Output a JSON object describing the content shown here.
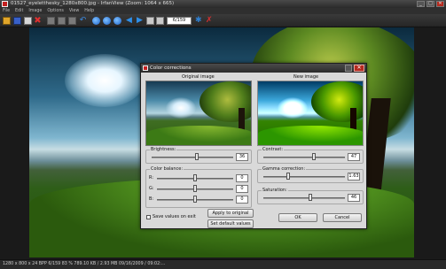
{
  "window": {
    "title": "01527_eyeletthesky_1280x800.jpg - IrfanView (Zoom: 1064 x 665)",
    "controls": [
      "_",
      "□",
      "✕"
    ]
  },
  "menu": [
    "File",
    "Edit",
    "Image",
    "Options",
    "View",
    "Help"
  ],
  "toolbar": {
    "page_counter": "6/159",
    "icons": [
      "folder-open-icon",
      "save-icon",
      "print-icon",
      "delete-icon",
      "cut-icon",
      "copy-icon",
      "paste-icon",
      "undo-icon",
      "zoom-in-icon",
      "zoom-out-icon",
      "previous-icon",
      "next-icon",
      "fit-icon",
      "fullscreen-icon",
      "tools-icon",
      "exit-icon"
    ]
  },
  "statusbar": {
    "text": "1280 x 800 x 24 BPP   6/159   83 %   789.10 KB / 2.93 MB   09/16/2009 / 09:02:..."
  },
  "dialog": {
    "title": "Color corrections",
    "original_label": "Original image",
    "new_label": "New image",
    "brightness": {
      "label": "Brightness:",
      "value": "36",
      "level": 0.55
    },
    "contrast": {
      "label": "Contrast:",
      "value": "47",
      "level": 0.62
    },
    "color_balance": {
      "title": "Color balance:",
      "channels": [
        {
          "label": "R:",
          "value": "0",
          "level": 0.5
        },
        {
          "label": "G:",
          "value": "0",
          "level": 0.5
        },
        {
          "label": "B:",
          "value": "0",
          "level": 0.5
        }
      ]
    },
    "gamma": {
      "label": "Gamma correction:",
      "value": "1.63",
      "level": 0.3
    },
    "saturation": {
      "label": "Saturation:",
      "value": "46",
      "level": 0.58
    },
    "save_checkbox_label": "Save values on exit",
    "apply_original_label": "Apply to original",
    "set_default_label": "Set default values",
    "ok_label": "OK",
    "cancel_label": "Cancel"
  }
}
